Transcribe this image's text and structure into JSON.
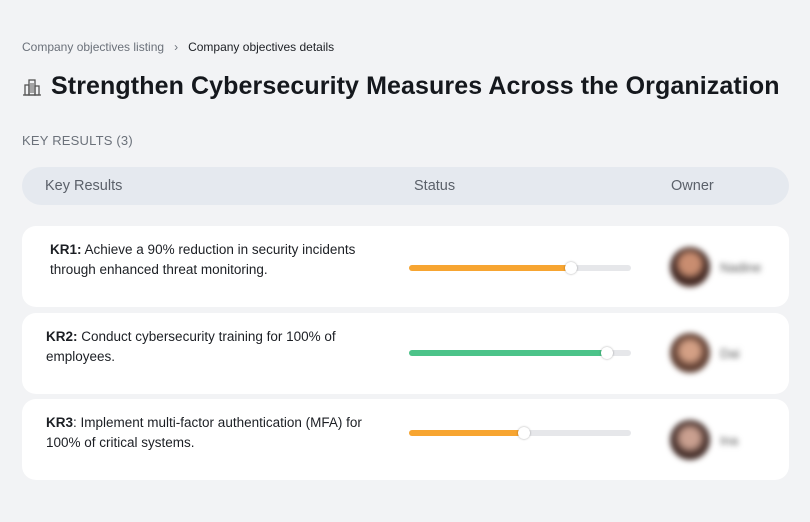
{
  "breadcrumb": {
    "parent": "Company objectives listing",
    "separator": "›",
    "current": "Company objectives details"
  },
  "objective": {
    "title": "Strengthen Cybersecurity Measures Across the Organization",
    "icon": "building-icon"
  },
  "key_results_label": "KEY RESULTS (3)",
  "table": {
    "columns": [
      "Key Results",
      "Status",
      "Owner"
    ]
  },
  "colors": {
    "progress_orange": "#f7a531",
    "progress_green": "#4cc389",
    "track": "#e6e7ea"
  },
  "rows": [
    {
      "id": "KR1:",
      "text": " Achieve a 90% reduction in security incidents through enhanced threat monitoring.",
      "progress": 0.73,
      "color": "#f7a531",
      "owner": "Nadine"
    },
    {
      "id": "KR2:",
      "text": " Conduct cybersecurity training for 100% of employees.",
      "progress": 0.89,
      "color": "#4cc389",
      "owner": "Dai"
    },
    {
      "id": "KR3",
      "text": ": Implement multi-factor authentication (MFA) for 100% of critical systems.",
      "progress": 0.52,
      "color": "#f7a531",
      "owner": "Ina"
    }
  ]
}
